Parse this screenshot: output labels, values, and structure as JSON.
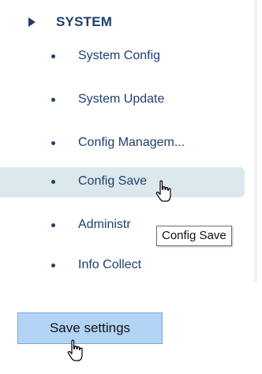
{
  "sidebar": {
    "section": {
      "title": "SYSTEM",
      "icon": "expand-arrow-icon"
    },
    "items": [
      {
        "label": "System Config"
      },
      {
        "label": "System Update"
      },
      {
        "label": "Config Managem..."
      },
      {
        "label": "Config Save",
        "active": true
      },
      {
        "label": "Administr"
      },
      {
        "label": "Info Collect"
      }
    ]
  },
  "tooltip": {
    "text": "Config Save"
  },
  "actions": {
    "save_label": "Save settings"
  },
  "colors": {
    "menu_text": "#1f3f6e",
    "active_bg": "#dbe8ec",
    "button_bg": "#b3d4f5",
    "button_border": "#7aa7d6"
  },
  "cursor": {
    "icon": "hand-pointer-icon"
  }
}
